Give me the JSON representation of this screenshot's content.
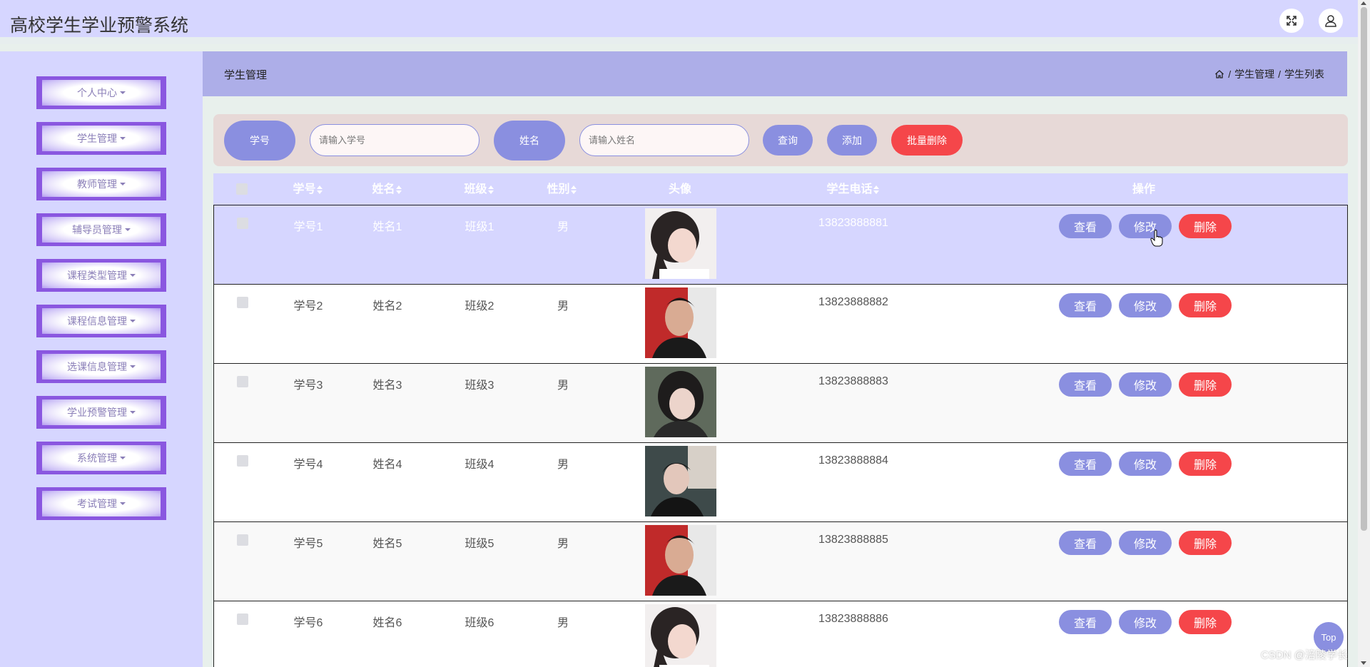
{
  "app": {
    "title": "高校学生学业预警系统"
  },
  "header": {
    "fullscreen_icon": "expand-icon",
    "user_icon": "user-icon"
  },
  "sidebar": {
    "items": [
      {
        "label": "个人中心"
      },
      {
        "label": "学生管理"
      },
      {
        "label": "教师管理"
      },
      {
        "label": "辅导员管理"
      },
      {
        "label": "课程类型管理"
      },
      {
        "label": "课程信息管理"
      },
      {
        "label": "选课信息管理"
      },
      {
        "label": "学业预警管理"
      },
      {
        "label": "系统管理"
      },
      {
        "label": "考试管理"
      }
    ]
  },
  "breadcrumb": {
    "title": "学生管理",
    "home_icon": "home-icon",
    "sep1": "/",
    "level1": "学生管理",
    "sep2": "/",
    "level2": "学生列表"
  },
  "search": {
    "id_label": "学号",
    "id_placeholder": "请输入学号",
    "name_label": "姓名",
    "name_placeholder": "请输入姓名",
    "query_label": "查询",
    "add_label": "添加",
    "batch_delete_label": "批量删除"
  },
  "table": {
    "columns": {
      "id": "学号",
      "name": "姓名",
      "class": "班级",
      "gender": "性别",
      "avatar": "头像",
      "phone": "学生电话",
      "ops": "操作"
    },
    "actions": {
      "view": "查看",
      "edit": "修改",
      "delete": "删除"
    },
    "rows": [
      {
        "id": "学号1",
        "name": "姓名1",
        "class": "班级1",
        "gender": "男",
        "phone": "13823888881"
      },
      {
        "id": "学号2",
        "name": "姓名2",
        "class": "班级2",
        "gender": "男",
        "phone": "13823888882"
      },
      {
        "id": "学号3",
        "name": "姓名3",
        "class": "班级3",
        "gender": "男",
        "phone": "13823888883"
      },
      {
        "id": "学号4",
        "name": "姓名4",
        "class": "班级4",
        "gender": "男",
        "phone": "13823888884"
      },
      {
        "id": "学号5",
        "name": "姓名5",
        "class": "班级5",
        "gender": "男",
        "phone": "13823888885"
      },
      {
        "id": "学号6",
        "name": "姓名6",
        "class": "班级6",
        "gender": "男",
        "phone": "13823888886"
      }
    ]
  },
  "top_button": {
    "label": "Top"
  },
  "watermark": {
    "text": "CSDN @涪陵学长"
  },
  "colors": {
    "accent": "#8a8fe0",
    "danger": "#f5464a",
    "header_bg": "#d6d6ff",
    "menu_border": "#8a57e0"
  }
}
